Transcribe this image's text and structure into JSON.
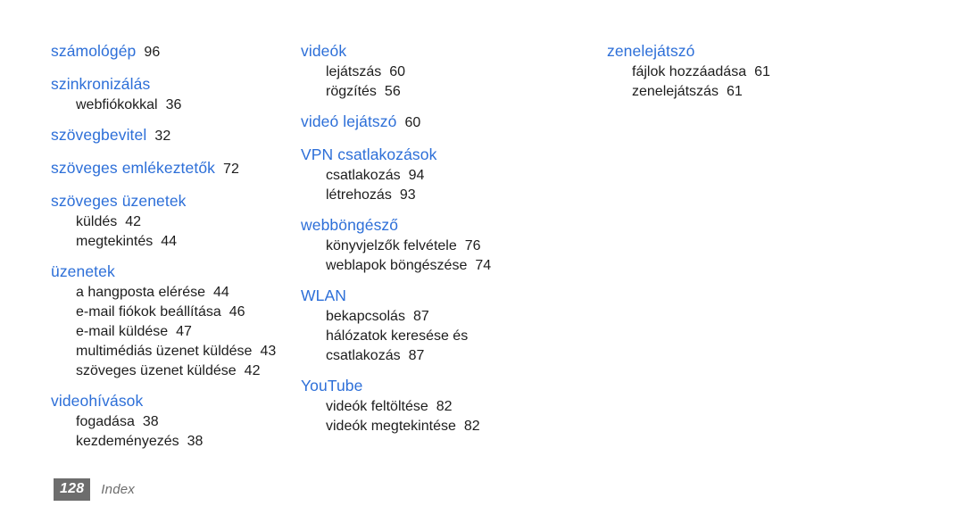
{
  "document": {
    "page_number": "128",
    "section_label": "Index",
    "heading_color": "#2d6fd8",
    "text_color": "#1d1d1d",
    "folio_box_color": "#6d6d6d",
    "background_color": "#ffffff"
  },
  "columns": [
    {
      "id": "column-1",
      "groups": [
        {
          "heading": "számológép",
          "heading_page": "96",
          "subentries": []
        },
        {
          "heading": "szinkronizálás",
          "heading_page": "",
          "subentries": [
            {
              "label": "webfiókokkal",
              "page": "36"
            }
          ]
        },
        {
          "heading": "szövegbevitel",
          "heading_page": "32",
          "subentries": []
        },
        {
          "heading": "szöveges emlékeztetők",
          "heading_page": "72",
          "subentries": []
        },
        {
          "heading": "szöveges üzenetek",
          "heading_page": "",
          "subentries": [
            {
              "label": "küldés",
              "page": "42"
            },
            {
              "label": "megtekintés",
              "page": "44"
            }
          ]
        },
        {
          "heading": "üzenetek",
          "heading_page": "",
          "subentries": [
            {
              "label": "a hangposta elérése",
              "page": "44"
            },
            {
              "label": "e-mail fiókok beállítása",
              "page": "46"
            },
            {
              "label": "e-mail küldése",
              "page": "47"
            },
            {
              "label": "multimédiás üzenet küldése",
              "page": "43"
            },
            {
              "label": "szöveges üzenet küldése",
              "page": "42"
            }
          ]
        },
        {
          "heading": "videohívások",
          "heading_page": "",
          "subentries": [
            {
              "label": "fogadása",
              "page": "38"
            },
            {
              "label": "kezdeményezés",
              "page": "38"
            }
          ]
        }
      ]
    },
    {
      "id": "column-2",
      "groups": [
        {
          "heading": "videók",
          "heading_page": "",
          "subentries": [
            {
              "label": "lejátszás",
              "page": "60"
            },
            {
              "label": "rögzítés",
              "page": "56"
            }
          ]
        },
        {
          "heading": "videó lejátszó",
          "heading_page": "60",
          "subentries": []
        },
        {
          "heading": "VPN csatlakozások",
          "heading_page": "",
          "subentries": [
            {
              "label": "csatlakozás",
              "page": "94"
            },
            {
              "label": "létrehozás",
              "page": "93"
            }
          ]
        },
        {
          "heading": "webböngésző",
          "heading_page": "",
          "subentries": [
            {
              "label": "könyvjelzők felvétele",
              "page": "76"
            },
            {
              "label": "weblapok böngészése",
              "page": "74"
            }
          ]
        },
        {
          "heading": "WLAN",
          "heading_page": "",
          "subentries": [
            {
              "label": "bekapcsolás",
              "page": "87"
            },
            {
              "label": "hálózatok keresése és",
              "page": ""
            },
            {
              "label": "csatlakozás",
              "page": "87"
            }
          ]
        },
        {
          "heading": "YouTube",
          "heading_page": "",
          "subentries": [
            {
              "label": "videók feltöltése",
              "page": "82"
            },
            {
              "label": "videók megtekintése",
              "page": "82"
            }
          ]
        }
      ]
    },
    {
      "id": "column-3",
      "groups": [
        {
          "heading": "zenelejátszó",
          "heading_page": "",
          "subentries": [
            {
              "label": "fájlok hozzáadása",
              "page": "61"
            },
            {
              "label": "zenelejátszás",
              "page": "61"
            }
          ]
        }
      ]
    }
  ]
}
